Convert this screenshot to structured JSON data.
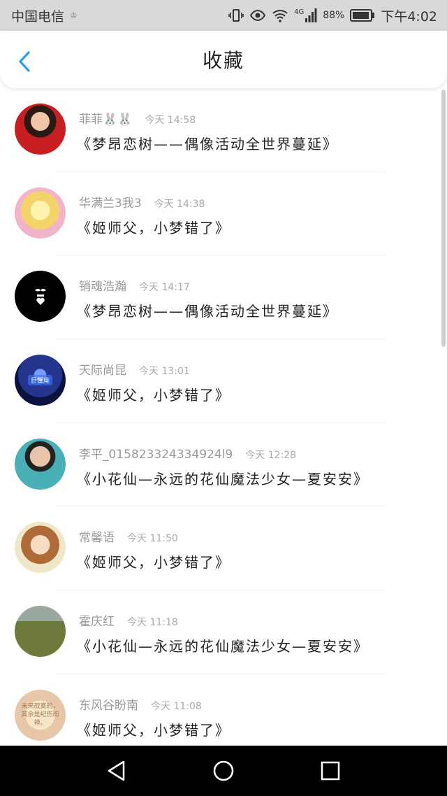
{
  "status": {
    "carrier": "中国电信",
    "carrier_badge": "♔",
    "network": "4G",
    "battery": "88%",
    "time": "下午4:02"
  },
  "header": {
    "title": "收藏",
    "back_icon": "chevron-left-icon"
  },
  "items": [
    {
      "name": "菲菲🐰🐰",
      "time": "今天 14:58",
      "title": "《梦昂恋树——偶像活动全世界蔓延》"
    },
    {
      "name": "华满兰3我3",
      "time": "今天 14:38",
      "title": "《姬师父，小梦错了》"
    },
    {
      "name": "销魂浩瀚",
      "time": "今天 14:17",
      "title": "《梦昂恋树——偶像活动全世界蔓延》"
    },
    {
      "name": "天际尚昆",
      "time": "今天 13:01",
      "title": "《姬师父，小梦错了》",
      "avatar_tag": "巨蟹座"
    },
    {
      "name": "李平_015823324334924l9",
      "time": "今天 12:28",
      "title": "《小花仙—永远的花仙魔法少女—夏安安》"
    },
    {
      "name": "常馨语",
      "time": "今天 11:50",
      "title": "《姬师父，小梦错了》"
    },
    {
      "name": "霍庆红",
      "time": "今天 11:18",
      "title": "《小花仙—永远的花仙魔法少女—夏安安》"
    },
    {
      "name": "东风谷盼南",
      "time": "今天 11:08",
      "title": "《姬师父，小梦错了》",
      "avatar_text": "未来寂寞的，其余是纪伤雨禅。"
    }
  ],
  "nav": {
    "back": "triangle-back-icon",
    "home": "circle-home-icon",
    "recents": "square-recents-icon"
  }
}
